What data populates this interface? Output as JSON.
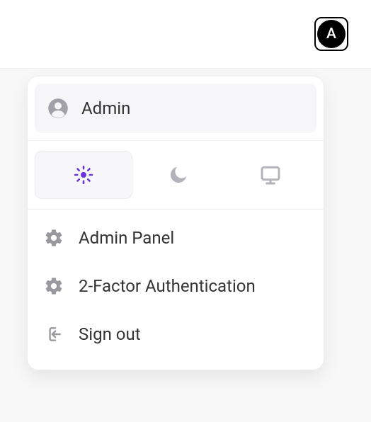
{
  "avatar": {
    "initial": "A"
  },
  "menu": {
    "user": {
      "name": "Admin"
    },
    "theme": {
      "active": "light"
    },
    "items": [
      {
        "label": "Admin Panel"
      },
      {
        "label": "2-Factor Authentication"
      },
      {
        "label": "Sign out"
      }
    ]
  }
}
